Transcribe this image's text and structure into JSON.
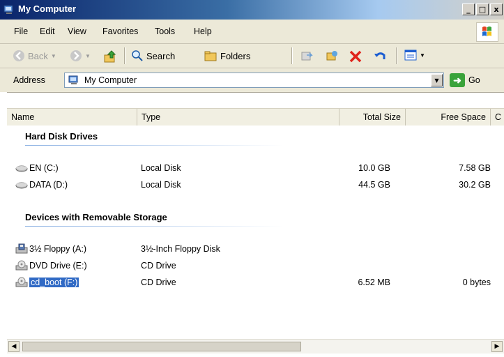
{
  "window": {
    "title": "My Computer",
    "buttons": [
      "_",
      "□",
      "x"
    ]
  },
  "menu": [
    {
      "label": "File",
      "mnemonic": "F"
    },
    {
      "label": "Edit",
      "mnemonic": "E"
    },
    {
      "label": "View",
      "mnemonic": "V"
    },
    {
      "label": "Favorites",
      "mnemonic": "a"
    },
    {
      "label": "Tools",
      "mnemonic": "T"
    },
    {
      "label": "Help",
      "mnemonic": "H"
    }
  ],
  "toolbar": {
    "back_label": "Back",
    "search_label": "Search",
    "folders_label": "Folders"
  },
  "address": {
    "label": "Address",
    "value": "My Computer",
    "go_label": "Go"
  },
  "columns": [
    "Name",
    "Type",
    "Total Size",
    "Free Space",
    "C"
  ],
  "groups": [
    {
      "title": "Hard Disk Drives",
      "items": [
        {
          "name": "EN (C:)",
          "type": "Local Disk",
          "total": "10.0 GB",
          "free": "7.58 GB",
          "icon": "hard-disk-icon"
        },
        {
          "name": "DATA (D:)",
          "type": "Local Disk",
          "total": "44.5 GB",
          "free": "30.2 GB",
          "icon": "hard-disk-icon"
        }
      ]
    },
    {
      "title": "Devices with Removable Storage",
      "items": [
        {
          "name": "3½ Floppy (A:)",
          "type": "3½-Inch Floppy Disk",
          "total": "",
          "free": "",
          "icon": "floppy-drive-icon"
        },
        {
          "name": "DVD Drive (E:)",
          "type": "CD Drive",
          "total": "",
          "free": "",
          "icon": "cd-drive-icon"
        },
        {
          "name": "cd_boot (F:)",
          "type": "CD Drive",
          "total": "6.52 MB",
          "free": "0 bytes",
          "icon": "cd-drive-icon",
          "selected": true
        }
      ]
    }
  ],
  "colors": {
    "title_gradient_start": "#0a246a",
    "selection": "#316ac5",
    "toolbar_bg": "#ece9d8"
  }
}
